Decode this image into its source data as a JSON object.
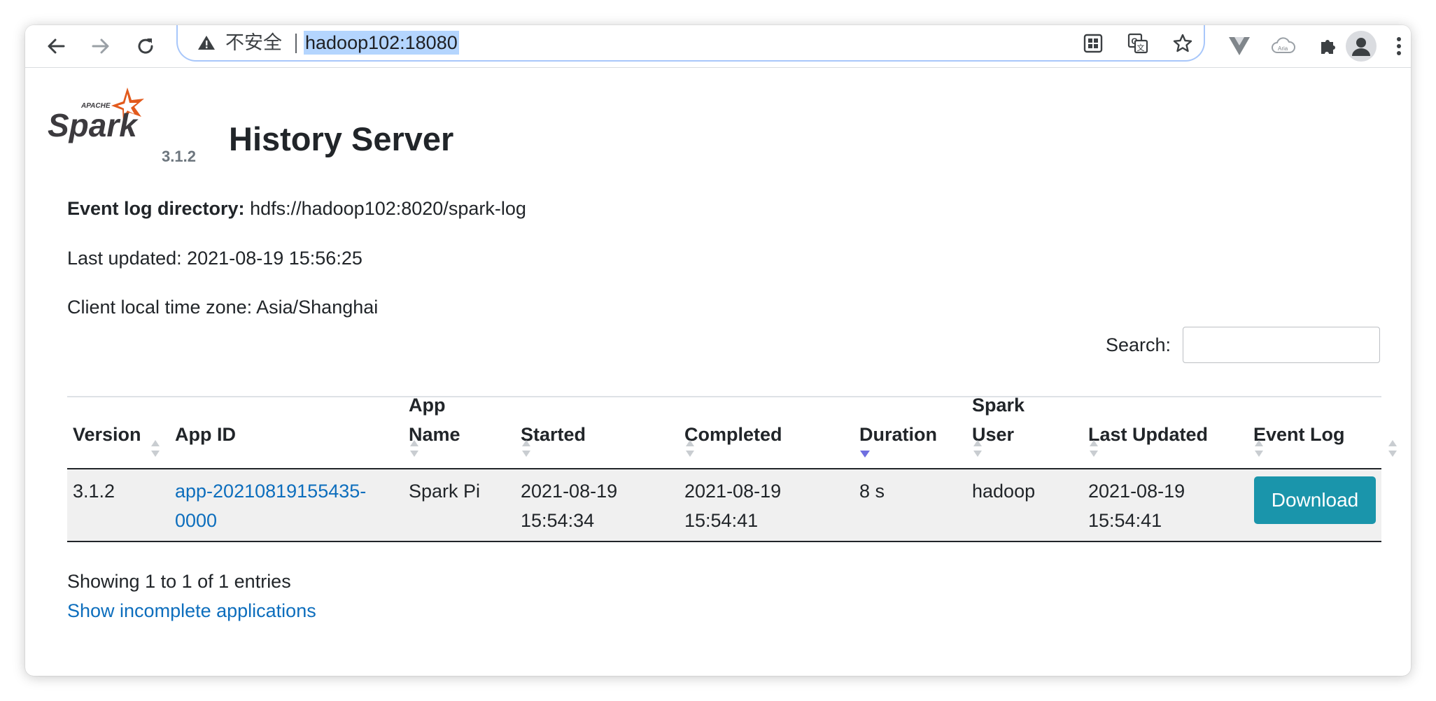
{
  "browser": {
    "omnibox": {
      "security_text": "不安全",
      "url": "hadoop102:18080"
    },
    "icons": {
      "back": "arrow-left-icon",
      "forward": "arrow-right-icon",
      "reload": "reload-icon",
      "warning": "warning-triangle-icon",
      "qr": "qr-code-icon",
      "translate": "translate-icon",
      "bookmark": "star-icon",
      "ext1": "vue-devtools-icon",
      "ext2": "aria-cloud-icon",
      "extensions": "puzzle-icon",
      "profile": "avatar-icon",
      "menu": "kebab-menu-icon"
    },
    "ext2_text": "Aria"
  },
  "header": {
    "logo_apache": "APACHE",
    "logo_text": "Spark",
    "version": "3.1.2",
    "title": "History Server"
  },
  "info": {
    "event_log_label": "Event log directory:",
    "event_log_value": "hdfs://hadoop102:8020/spark-log",
    "last_updated": "Last updated: 2021-08-19 15:56:25",
    "timezone": "Client local time zone: Asia/Shanghai"
  },
  "search": {
    "label": "Search:",
    "value": ""
  },
  "table": {
    "headers": {
      "version": "Version",
      "app_id": "App ID",
      "app_name_1": "App",
      "app_name_2": "Name",
      "started": "Started",
      "completed": "Completed",
      "duration": "Duration",
      "spark_user_1": "Spark",
      "spark_user_2": "User",
      "last_updated": "Last Updated",
      "event_log": "Event Log"
    },
    "sorted_column": "Completed",
    "sort_direction": "descending",
    "rows": [
      {
        "version": "3.1.2",
        "app_id_1": "app-20210819155435-",
        "app_id_2": "0000",
        "app_name": "Spark Pi",
        "started_1": "2021-08-19",
        "started_2": "15:54:34",
        "completed_1": "2021-08-19",
        "completed_2": "15:54:41",
        "duration": "8 s",
        "spark_user": "hadoop",
        "last_updated_1": "2021-08-19",
        "last_updated_2": "15:54:41",
        "event_log_button": "Download"
      }
    ]
  },
  "footer": {
    "showing": "Showing 1 to 1 of 1 entries",
    "incomplete_link": "Show incomplete applications"
  },
  "colors": {
    "link": "#0d6ebd",
    "download_button": "#1a95ab",
    "sort_active": "#6f6fe0",
    "row_background": "#f0f0f0"
  }
}
